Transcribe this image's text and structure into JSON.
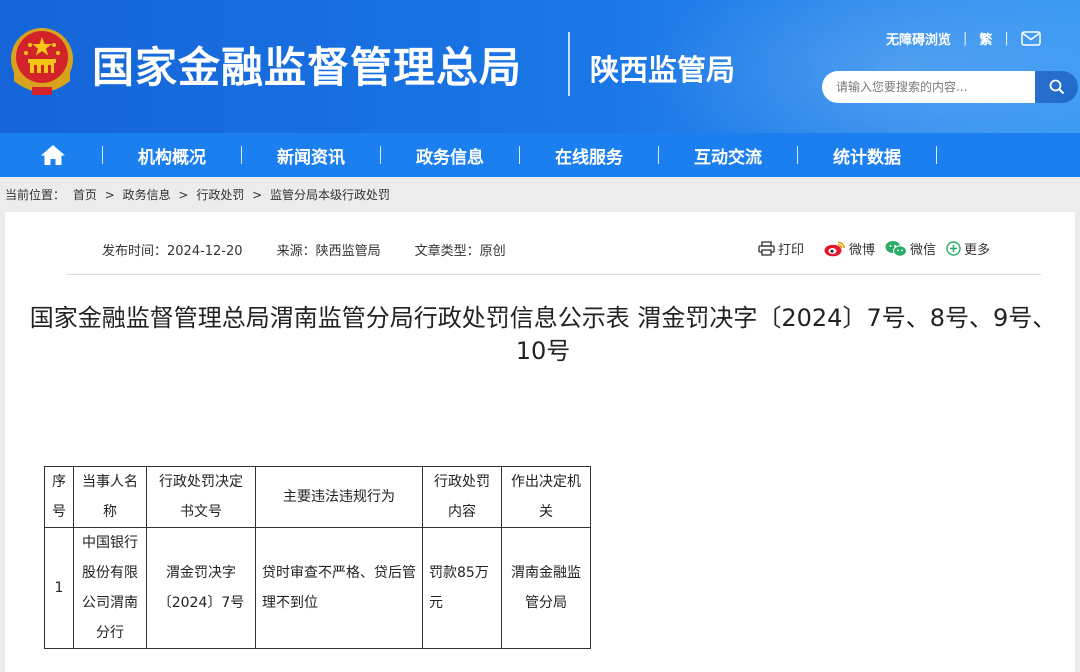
{
  "header": {
    "agency_name": "国家金融监督管理总局",
    "branch_name": "陕西监管局",
    "accessibility_link": "无障碍浏览",
    "traditional_link": "繁",
    "search_placeholder": "请输入您要搜索的内容..."
  },
  "nav": {
    "items": [
      "机构概况",
      "新闻资讯",
      "政务信息",
      "在线服务",
      "互动交流",
      "统计数据"
    ]
  },
  "breadcrumb": {
    "label": "当前位置：",
    "items": [
      "首页",
      "政务信息",
      "行政处罚",
      "监管分局本级行政处罚"
    ],
    "separator": ">"
  },
  "article": {
    "publish_time": "发布时间：2024-12-20",
    "source": "来源：陕西监管局",
    "type": "文章类型：原创",
    "actions": {
      "print": "打印",
      "weibo": "微博",
      "wechat": "微信",
      "more": "更多"
    },
    "title": "国家金融监督管理总局渭南监管分局行政处罚信息公示表 渭金罚决字〔2024〕7号、8号、9号、10号"
  },
  "table": {
    "headers": [
      "序号",
      "当事人名称",
      "行政处罚决定书文号",
      "主要违法违规行为",
      "行政处罚内容",
      "作出决定机关"
    ],
    "rows": [
      [
        "1",
        "中国银行股份有限公司渭南分行",
        "渭金罚决字〔2024〕7号",
        "贷时审查不严格、贷后管理不到位",
        "罚款85万元",
        "渭南金融监管分局"
      ]
    ]
  },
  "colors": {
    "header_blue": "#1565d8",
    "nav_blue": "#1b7ff0",
    "search_button": "#1864c8",
    "weibo_red": "#e6162d",
    "wechat_green": "#2aae67"
  }
}
